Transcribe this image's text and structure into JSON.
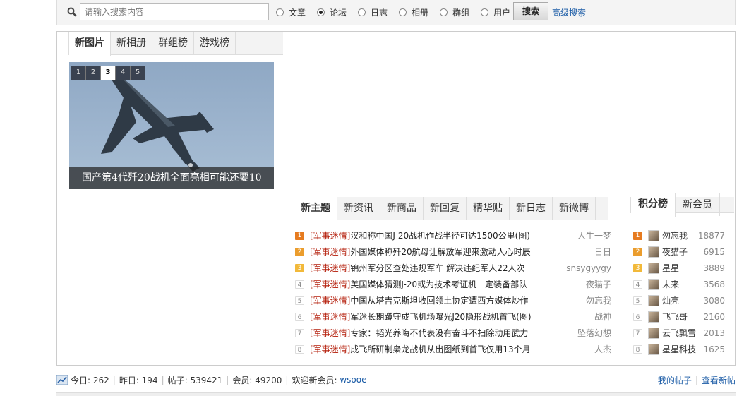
{
  "search": {
    "placeholder": "请输入搜索内容",
    "options": [
      "文章",
      "论坛",
      "日志",
      "相册",
      "群组",
      "用户"
    ],
    "selected": "论坛",
    "button": "搜索",
    "advanced": "高级搜索"
  },
  "pic_tabs": [
    "新图片",
    "新相册",
    "群组榜",
    "游戏榜"
  ],
  "slideshow": {
    "pages": [
      "1",
      "2",
      "3",
      "4",
      "5"
    ],
    "current": "3",
    "caption": "国产第4代歼20战机全面亮相可能还要10"
  },
  "post_tabs": [
    "新主题",
    "新资讯",
    "新商品",
    "新回复",
    "精华贴",
    "新日志",
    "新微博"
  ],
  "posts": [
    {
      "num": "1",
      "cat": "[军事迷情]",
      "title": "汉和称中国J-20战机作战半径可达1500公里(图)",
      "author": "人生一梦"
    },
    {
      "num": "2",
      "cat": "[军事迷情]",
      "title": "外国媒体称歼20航母让解放军迎来激动人心时辰",
      "author": "日日"
    },
    {
      "num": "3",
      "cat": "[军事迷情]",
      "title": "锦州军分区查处违规军车 解决违纪军人22人次",
      "author": "snsygyygy"
    },
    {
      "num": "4",
      "cat": "[军事迷情]",
      "title": "美国媒体猜测J-20或为技术考证机一定装备部队",
      "author": "夜猫子"
    },
    {
      "num": "5",
      "cat": "[军事迷情]",
      "title": "中国从塔吉克斯坦收回领土协定遭西方媒体炒作",
      "author": "勿忘我"
    },
    {
      "num": "6",
      "cat": "[军事迷情]",
      "title": "军迷长期蹲守成飞机场曝光J20隐形战机首飞(图)",
      "author": "战神"
    },
    {
      "num": "7",
      "cat": "[军事迷情]",
      "title": "专家：韬光养晦不代表没有奋斗不扫除动用武力",
      "author": "坠落幻想"
    },
    {
      "num": "8",
      "cat": "[军事迷情]",
      "title": "成飞所研制枭龙战机从出图纸到首飞仅用13个月",
      "author": "人杰"
    }
  ],
  "rank_tabs": [
    "积分榜",
    "新会员"
  ],
  "ranks": [
    {
      "num": "1",
      "name": "勿忘我",
      "score": "18877"
    },
    {
      "num": "2",
      "name": "夜猫子",
      "score": "6915"
    },
    {
      "num": "3",
      "name": "星星",
      "score": "3889"
    },
    {
      "num": "4",
      "name": "未来",
      "score": "3568"
    },
    {
      "num": "5",
      "name": "灿亮",
      "score": "3080"
    },
    {
      "num": "6",
      "name": "飞飞哥",
      "score": "2160"
    },
    {
      "num": "7",
      "name": "云飞飘雪",
      "score": "2013"
    },
    {
      "num": "8",
      "name": "星星科技",
      "score": "1625"
    }
  ],
  "stats": {
    "today": "今日: 262",
    "yesterday": "昨日: 194",
    "posts": "帖子: 539421",
    "members": "会员: 49200",
    "welcome": "欢迎新会员:",
    "newuser": "wsooe",
    "my_posts": "我的帖子",
    "view_new": "查看新帖"
  }
}
